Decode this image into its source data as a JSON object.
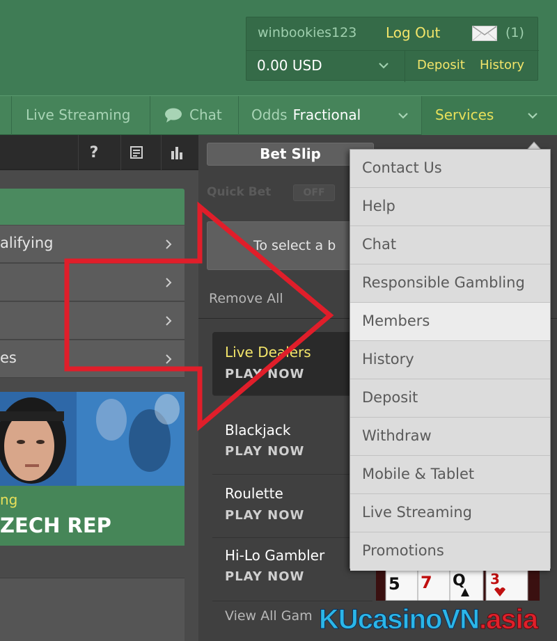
{
  "header": {
    "username": "winbookies123",
    "logout_label": "Log Out",
    "message_count": "(1)",
    "balance": "0.00 USD",
    "deposit_label": "Deposit",
    "history_label": "History"
  },
  "navbar": {
    "live_streaming_label": "Live Streaming",
    "chat_label": "Chat",
    "odds_label": "Odds",
    "odds_value": "Fractional",
    "services_label": "Services"
  },
  "left_panel": {
    "toolbar_icons": [
      "help-icon",
      "list-icon",
      "stats-icon"
    ],
    "help_glyph": "?",
    "menu_items": [
      {
        "label": "alifying"
      },
      {
        "label": ""
      },
      {
        "label": ""
      },
      {
        "label": "es"
      }
    ],
    "promo": {
      "subtitle": "ng",
      "title": "ZECH REP"
    }
  },
  "bet_slip": {
    "tab_label": "Bet Slip",
    "quick_bet_label": "Quick Bet",
    "quick_bet_state": "OFF",
    "select_text": "To select a b",
    "remove_all_label": "Remove All",
    "games": [
      {
        "name": "Live Dealers",
        "cta": "PLAY NOW",
        "highlight": true
      },
      {
        "name": "Blackjack",
        "cta": "PLAY NOW",
        "highlight": false
      },
      {
        "name": "Roulette",
        "cta": "PLAY NOW",
        "highlight": false
      },
      {
        "name": "Hi-Lo Gambler",
        "cta": "PLAY NOW",
        "highlight": false
      }
    ],
    "view_all_label": "View All Gam",
    "playing_cards": [
      "5",
      "7",
      "Q",
      "3"
    ]
  },
  "services_menu": {
    "items": [
      "Contact Us",
      "Help",
      "Chat",
      "Responsible Gambling",
      "Members",
      "History",
      "Deposit",
      "Withdraw",
      "Mobile & Tablet",
      "Live Streaming",
      "Promotions"
    ],
    "hovered_item": "Members"
  },
  "watermark": {
    "part_a": "KUcasinoVN",
    "part_b": ".asia"
  },
  "colors": {
    "header_green": "#3f7c55",
    "nav_green": "#46845a",
    "accent_yellow": "#f3e56a",
    "annotation_red": "#e01e2a",
    "dropdown_bg": "#dcdcdc"
  }
}
